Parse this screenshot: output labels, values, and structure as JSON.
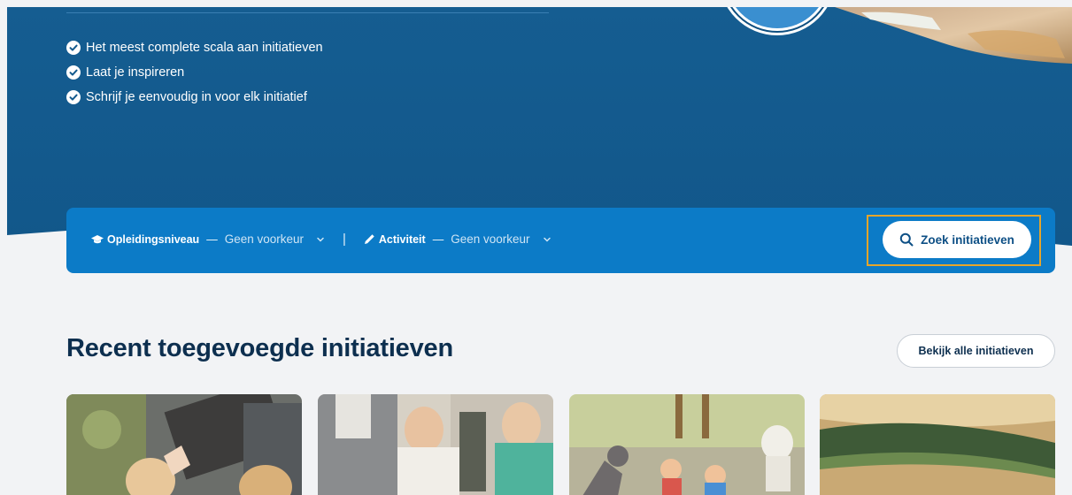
{
  "hero": {
    "features": [
      "Het meest complete scala aan initiatieven",
      "Laat je inspireren",
      "Schrijf je eenvoudig in voor elk initiatief"
    ],
    "colors": {
      "background": "#145b8e",
      "check": "#ffffff"
    }
  },
  "filters": {
    "level": {
      "icon": "graduation-cap-icon",
      "label": "Opleidingsniveau",
      "separator": "—",
      "value": "Geen voorkeur"
    },
    "activity": {
      "icon": "pencil-icon",
      "label": "Activiteit",
      "separator": "—",
      "value": "Geen voorkeur"
    },
    "divider": "|",
    "bar_color": "#0c7bc7"
  },
  "search": {
    "icon": "search-icon",
    "label": "Zoek initiatieven"
  },
  "recent": {
    "title": "Recent toegevoegde initiatieven",
    "view_all": "Bekijk alle initiatieven"
  }
}
